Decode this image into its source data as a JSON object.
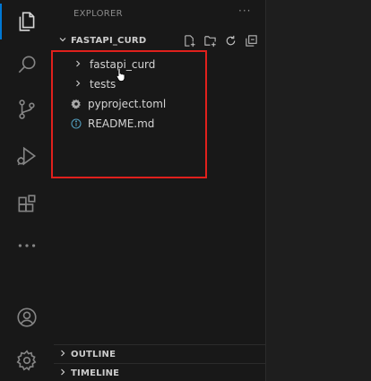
{
  "explorer": {
    "title": "EXPLORER",
    "more": "···"
  },
  "workspace": {
    "folder_name": "FASTAPI_CURD",
    "expanded": true
  },
  "tree": [
    {
      "label": "fastapi_curd",
      "type": "folder",
      "expanded": false
    },
    {
      "label": "tests",
      "type": "folder",
      "expanded": false
    },
    {
      "label": "pyproject.toml",
      "type": "file",
      "icon": "gear-file-icon"
    },
    {
      "label": "README.md",
      "type": "file",
      "icon": "info-icon"
    }
  ],
  "bottom_sections": {
    "outline": "OUTLINE",
    "timeline": "TIMELINE"
  },
  "activity_bar": [
    {
      "name": "explorer-icon",
      "active": true
    },
    {
      "name": "search-icon",
      "active": false
    },
    {
      "name": "source-control-icon",
      "active": false
    },
    {
      "name": "run-debug-icon",
      "active": false
    },
    {
      "name": "extensions-icon",
      "active": false
    },
    {
      "name": "more-icon",
      "active": false
    },
    {
      "name": "account-icon",
      "active": false
    },
    {
      "name": "settings-gear-icon",
      "active": false
    }
  ],
  "colors": {
    "accent": "#0078d4",
    "highlight_box": "#e0201c",
    "text": "#d4d4d4",
    "sidebar_bg": "#181818",
    "editor_bg": "#1e1e1e"
  }
}
